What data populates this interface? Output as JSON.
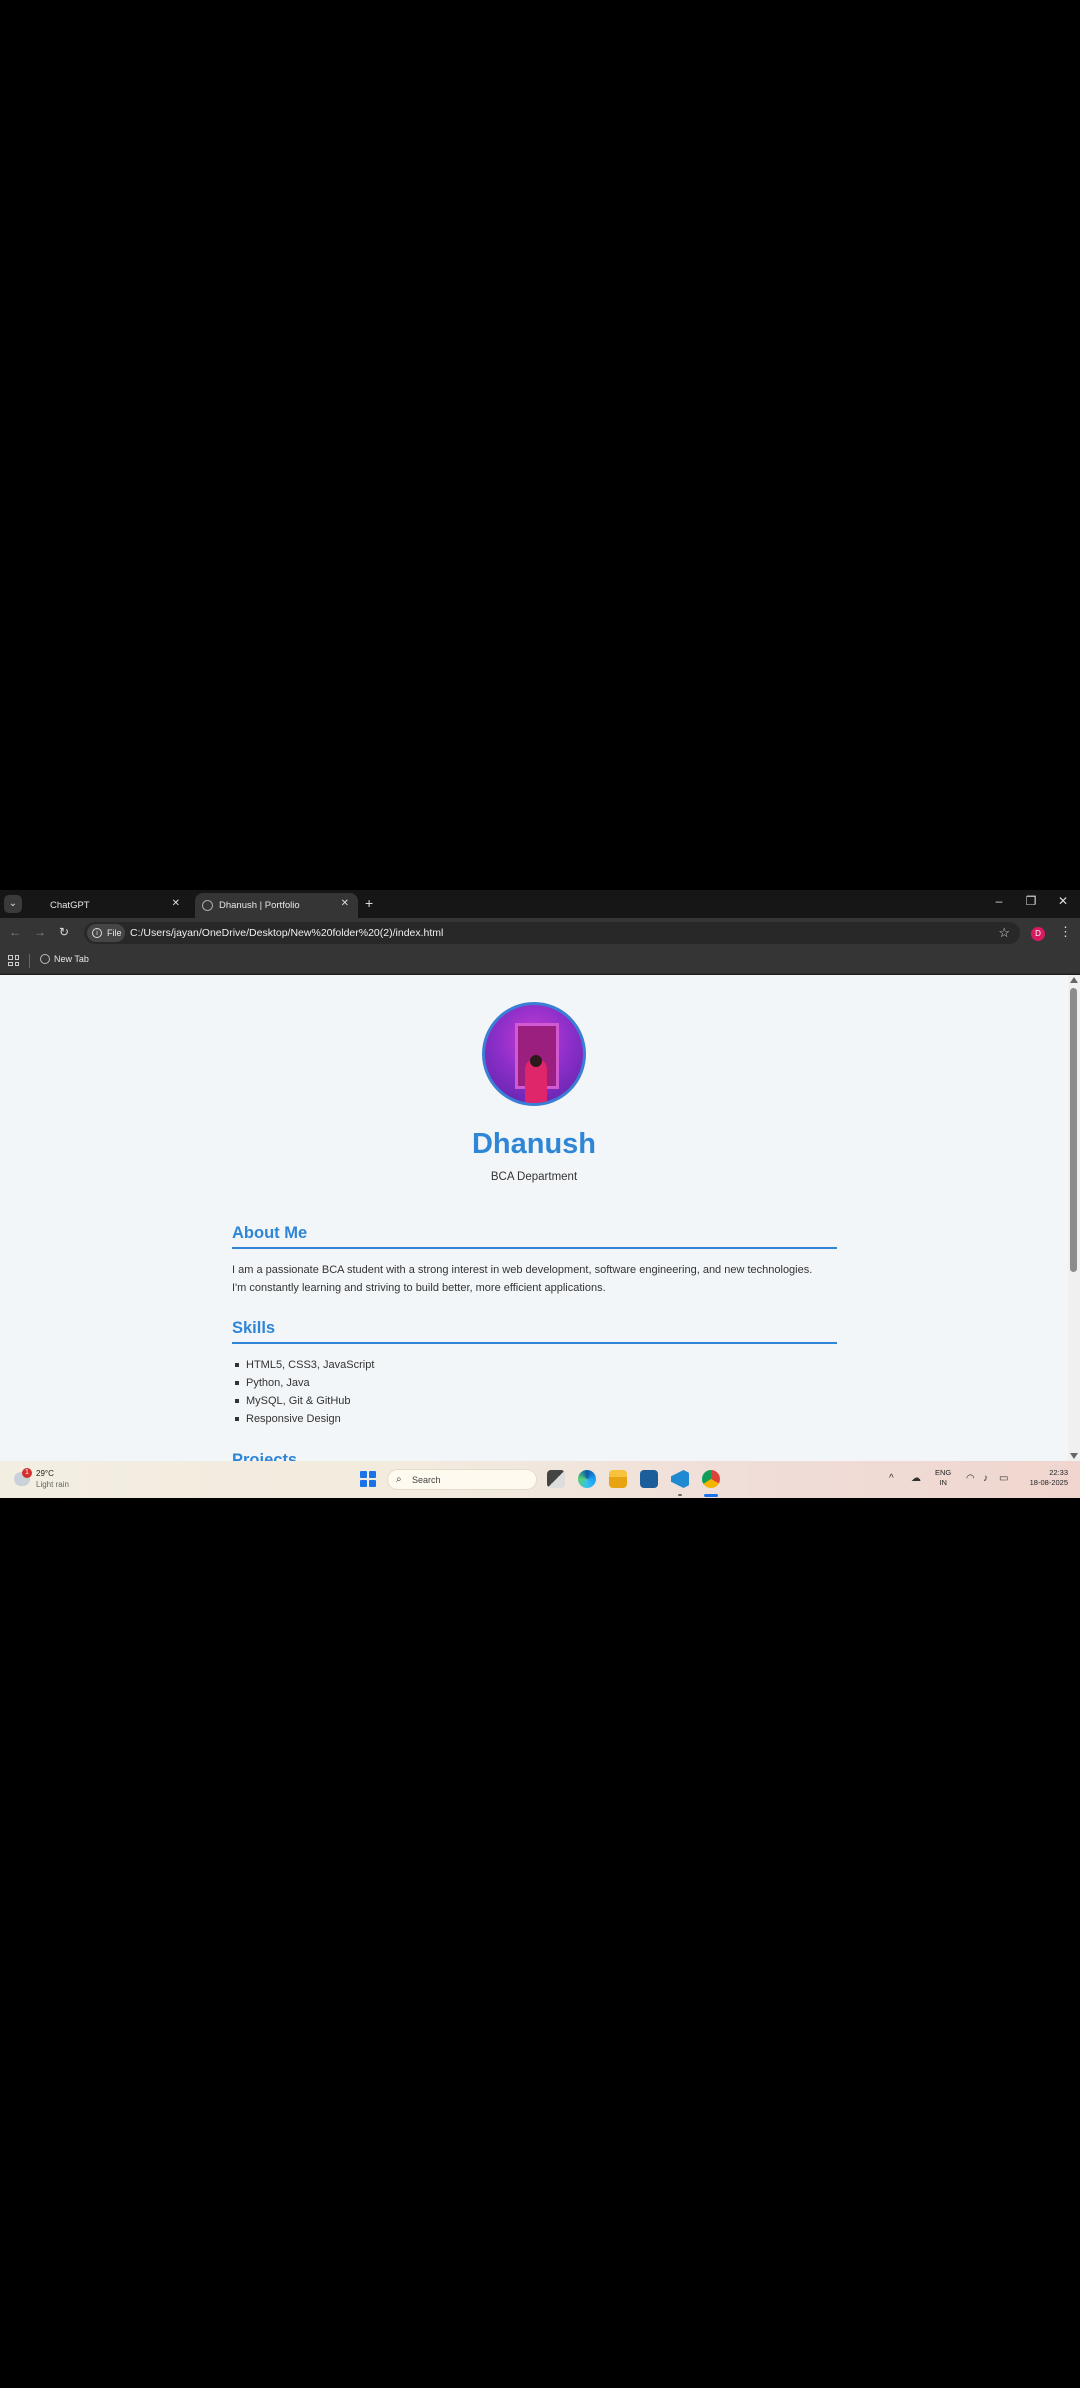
{
  "browser": {
    "tabs": [
      {
        "title": "ChatGPT",
        "active": false
      },
      {
        "title": "Dhanush | Portfolio",
        "active": true
      }
    ],
    "omnibox": {
      "scheme_chip": "File",
      "url": "C:/Users/jayan/OneDrive/Desktop/New%20folder%20(2)/index.html"
    },
    "profile_initial": "D",
    "bookmarks": [
      {
        "label": "New Tab"
      }
    ]
  },
  "page": {
    "name": "Dhanush",
    "department": "BCA Department",
    "about": {
      "heading": "About Me",
      "line1": "I am a passionate BCA student with a strong interest in web development, software engineering, and new technologies.",
      "line2": "I'm constantly learning and striving to build better, more efficient applications."
    },
    "skills": {
      "heading": "Skills",
      "items": [
        "HTML5, CSS3, JavaScript",
        "Python, Java",
        "MySQL, Git & GitHub",
        "Responsive Design"
      ]
    },
    "projects": {
      "heading": "Projects"
    }
  },
  "taskbar": {
    "weather": {
      "badge": "1",
      "temp": "29°C",
      "desc": "Light rain"
    },
    "search_placeholder": "Search",
    "lang_line1": "ENG",
    "lang_line2": "IN",
    "time": "22:33",
    "date": "18-08-2025"
  },
  "colors": {
    "accent": "#2f86d6",
    "page_bg": "#f3f6f8",
    "browser_chrome": "#353535"
  }
}
